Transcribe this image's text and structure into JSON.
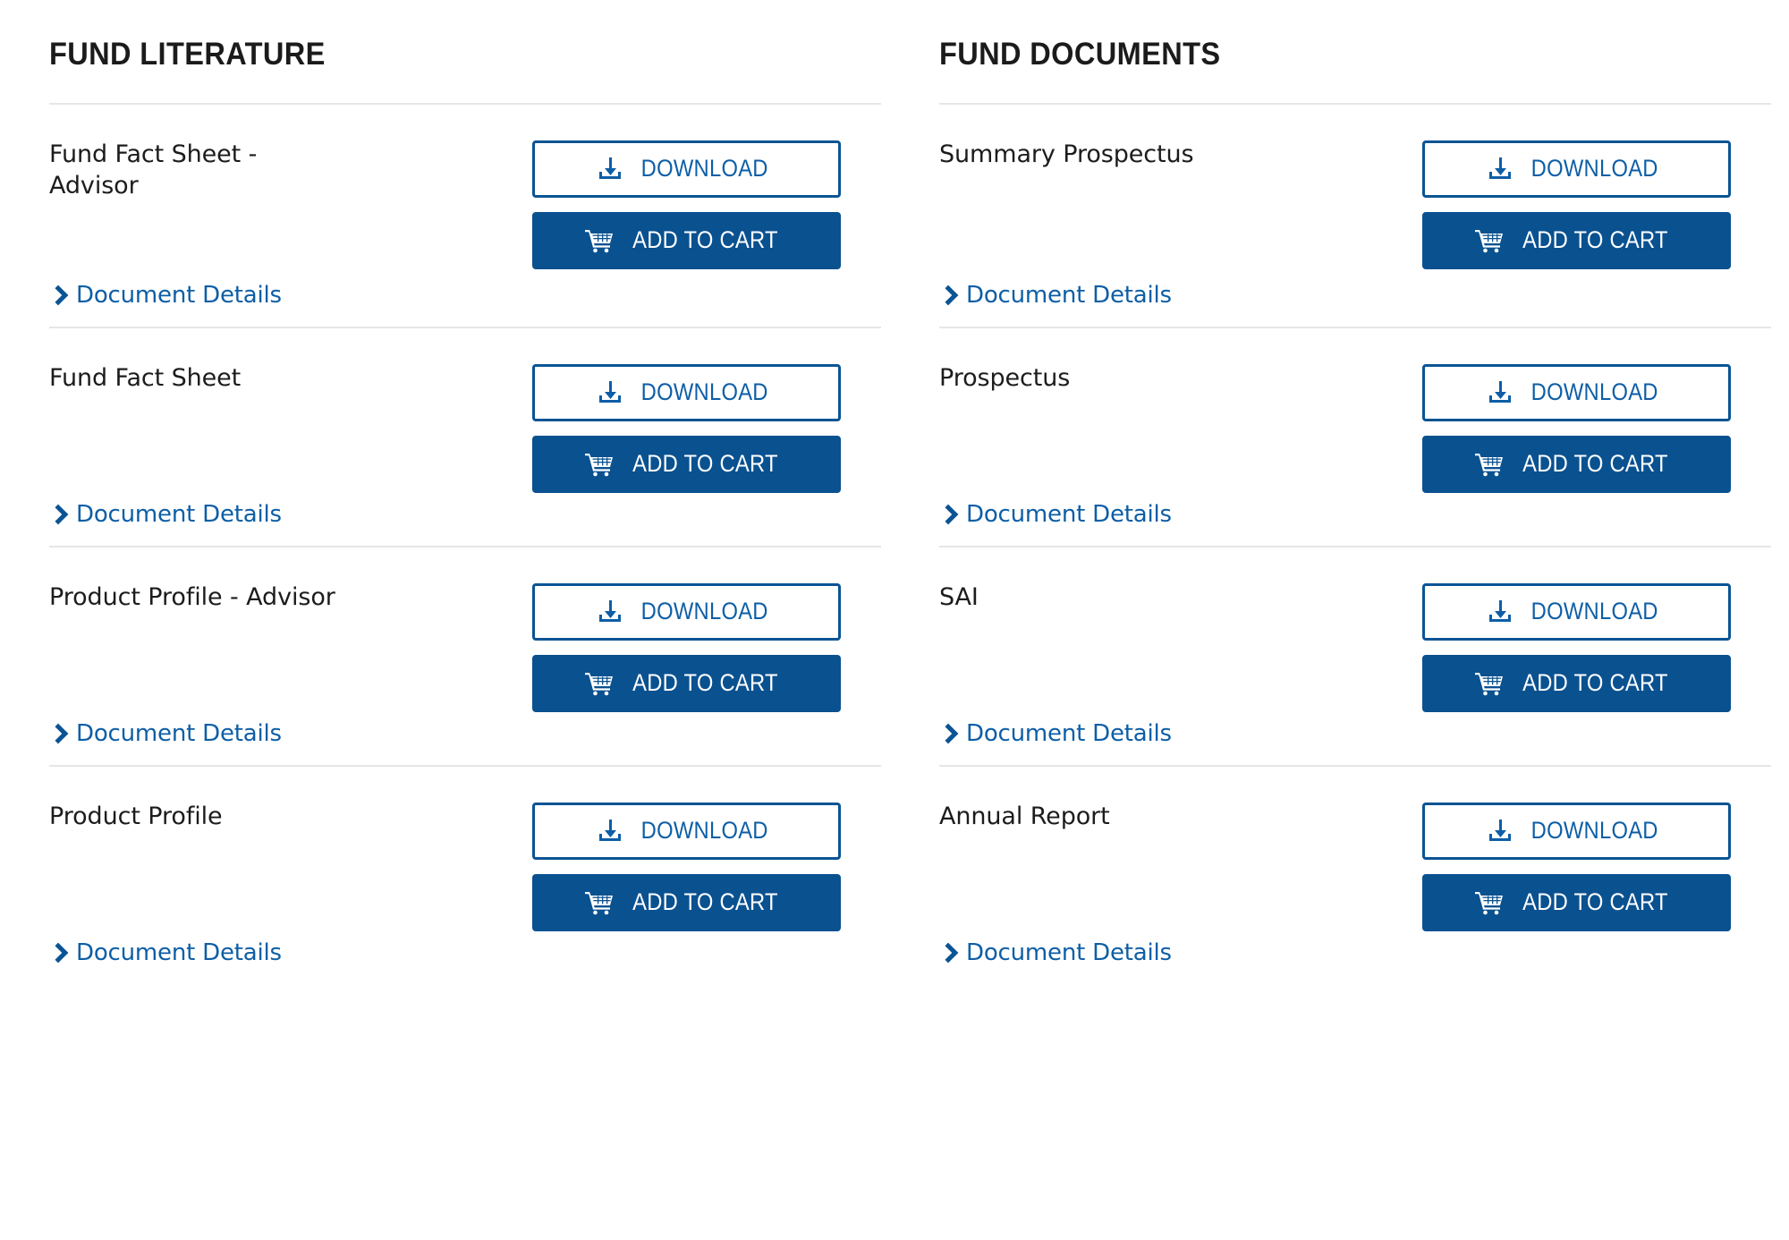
{
  "theme": {
    "brand_blue": "#0a5190",
    "border_blue": "#0a5494",
    "link_blue": "#0d5ea6",
    "divider_gray": "#e6e6e6",
    "title_color": "#1c1c1c",
    "background": "#ffffff"
  },
  "buttons": {
    "download_label": "DOWNLOAD",
    "add_to_cart_label": "ADD TO CART",
    "details_label": "Document Details",
    "download_icon": "download-icon",
    "cart_icon": "shopping-cart-icon",
    "details_icon": "chevron-right-icon"
  },
  "columns": [
    {
      "heading": "FUND LITERATURE",
      "rows": [
        {
          "title": "Fund Fact Sheet - Advisor"
        },
        {
          "title": "Fund Fact Sheet"
        },
        {
          "title": "Product Profile - Advisor"
        },
        {
          "title": "Product Profile"
        }
      ]
    },
    {
      "heading": "FUND DOCUMENTS",
      "rows": [
        {
          "title": "Summary Prospectus"
        },
        {
          "title": "Prospectus"
        },
        {
          "title": "SAI"
        },
        {
          "title": "Annual Report"
        }
      ]
    }
  ]
}
